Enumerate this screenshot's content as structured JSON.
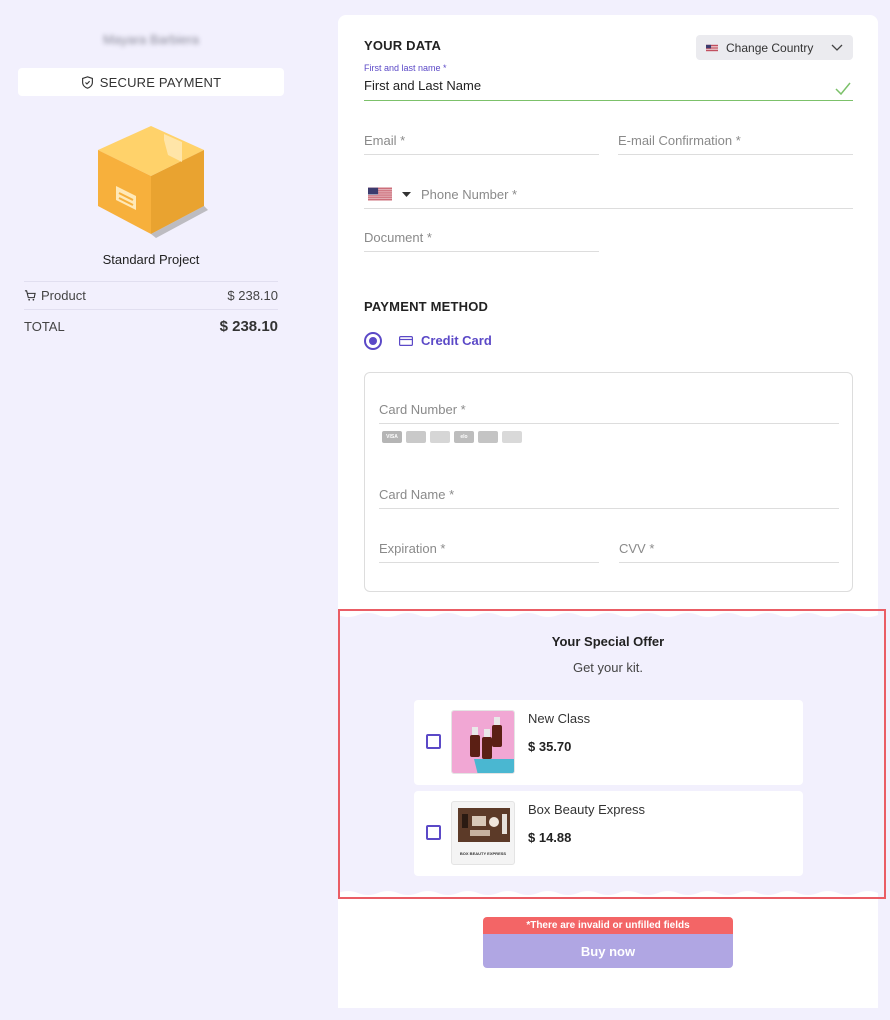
{
  "summary": {
    "seller_name": "Mayara Barbiera",
    "secure_label": "SECURE PAYMENT",
    "product_name": "Standard Project",
    "product_label": "Product",
    "product_price": "$ 238.10",
    "total_label": "TOTAL",
    "total_price": "$ 238.10"
  },
  "your_data": {
    "title": "YOUR DATA",
    "change_country": "Change Country",
    "name_label": "First and last name *",
    "name_value": "First and Last Name",
    "email_placeholder": "Email *",
    "email_confirm_placeholder": "E-mail Confirmation *",
    "phone_placeholder": "Phone Number *",
    "document_placeholder": "Document *"
  },
  "payment": {
    "title": "PAYMENT METHOD",
    "method_label": "Credit Card",
    "card_number_placeholder": "Card Number *",
    "card_brands": [
      "VISA",
      "master",
      "amex",
      "elo",
      "diners",
      "hiper"
    ],
    "card_name_placeholder": "Card Name *",
    "expiration_placeholder": "Expiration *",
    "cvv_placeholder": "CVV *"
  },
  "offer": {
    "title": "Your Special Offer",
    "subtitle": "Get your kit.",
    "items": [
      {
        "name": "New Class",
        "price": "$ 35.70"
      },
      {
        "name": "Box Beauty Express",
        "price": "$ 14.88",
        "thumb_caption": "BOX BEAUTY EXPRESS"
      }
    ]
  },
  "footer": {
    "error_text": "*There are invalid or unfilled fields",
    "buy_label": "Buy now"
  },
  "colors": {
    "accent": "#5b49c7",
    "background": "#f2f0fd",
    "error": "#f36566",
    "button_disabled": "#b0a6e3",
    "valid": "#7cc16a"
  }
}
